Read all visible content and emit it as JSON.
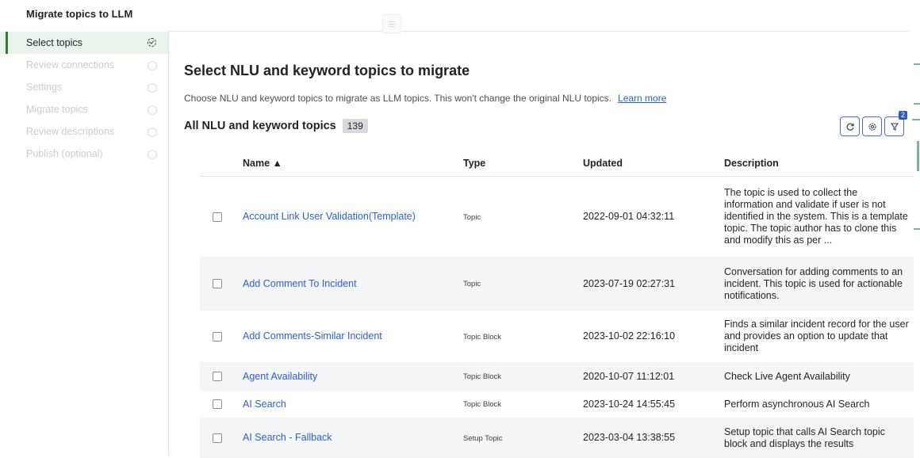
{
  "app": {
    "title": "Migrate topics to LLM"
  },
  "sidebar": {
    "steps": [
      {
        "label": "Select topics",
        "active": true
      },
      {
        "label": "Review connections",
        "active": false
      },
      {
        "label": "Settings",
        "active": false
      },
      {
        "label": "Migrate topics",
        "active": false
      },
      {
        "label": "Review descriptions",
        "active": false
      },
      {
        "label": "Publish (optional)",
        "active": false
      }
    ]
  },
  "main": {
    "heading": "Select NLU and keyword topics to migrate",
    "subtitle": "Choose NLU and keyword topics to migrate as LLM topics. This won't change the original NLU topics.",
    "learn_more": "Learn more",
    "list_title": "All NLU and keyword topics",
    "count": "139",
    "filter_badge": "2",
    "icons": {
      "refresh": "refresh-icon",
      "settings": "gear-icon",
      "filter": "filter-icon"
    }
  },
  "table": {
    "columns": [
      "Name ▲",
      "Type",
      "Updated",
      "Description"
    ],
    "rows": [
      {
        "name": "Account Link User Validation(Template)",
        "type": "Topic",
        "updated": "2022-09-01 04:32:11",
        "description": "The topic is used to collect the information and validate if user is not identified in the system. This is a template topic. The topic author has to clone this and modify this as per ..."
      },
      {
        "name": "Add Comment To Incident",
        "type": "Topic",
        "updated": "2023-07-19 02:27:31",
        "description": "Conversation for adding comments to an incident. This topic is used for actionable notifications."
      },
      {
        "name": "Add Comments-Similar Incident",
        "type": "Topic Block",
        "updated": "2023-10-02 22:16:10",
        "description": "Finds a similar incident record for the user and provides an option to update that incident"
      },
      {
        "name": "Agent Availability",
        "type": "Topic Block",
        "updated": "2020-10-07 11:12:01",
        "description": "Check Live Agent Availability"
      },
      {
        "name": "AI Search",
        "type": "Topic Block",
        "updated": "2023-10-24 14:55:45",
        "description": "Perform asynchronous AI Search"
      },
      {
        "name": "AI Search - Fallback",
        "type": "Setup Topic",
        "updated": "2023-03-04 13:38:55",
        "description": "Setup topic that calls AI Search topic block and displays the results"
      }
    ]
  },
  "colors": {
    "accent": "#2e7d32",
    "link": "#2c5fd6",
    "button_border": "#4a6bd8",
    "active_step_bg": "#e8f4ec"
  }
}
